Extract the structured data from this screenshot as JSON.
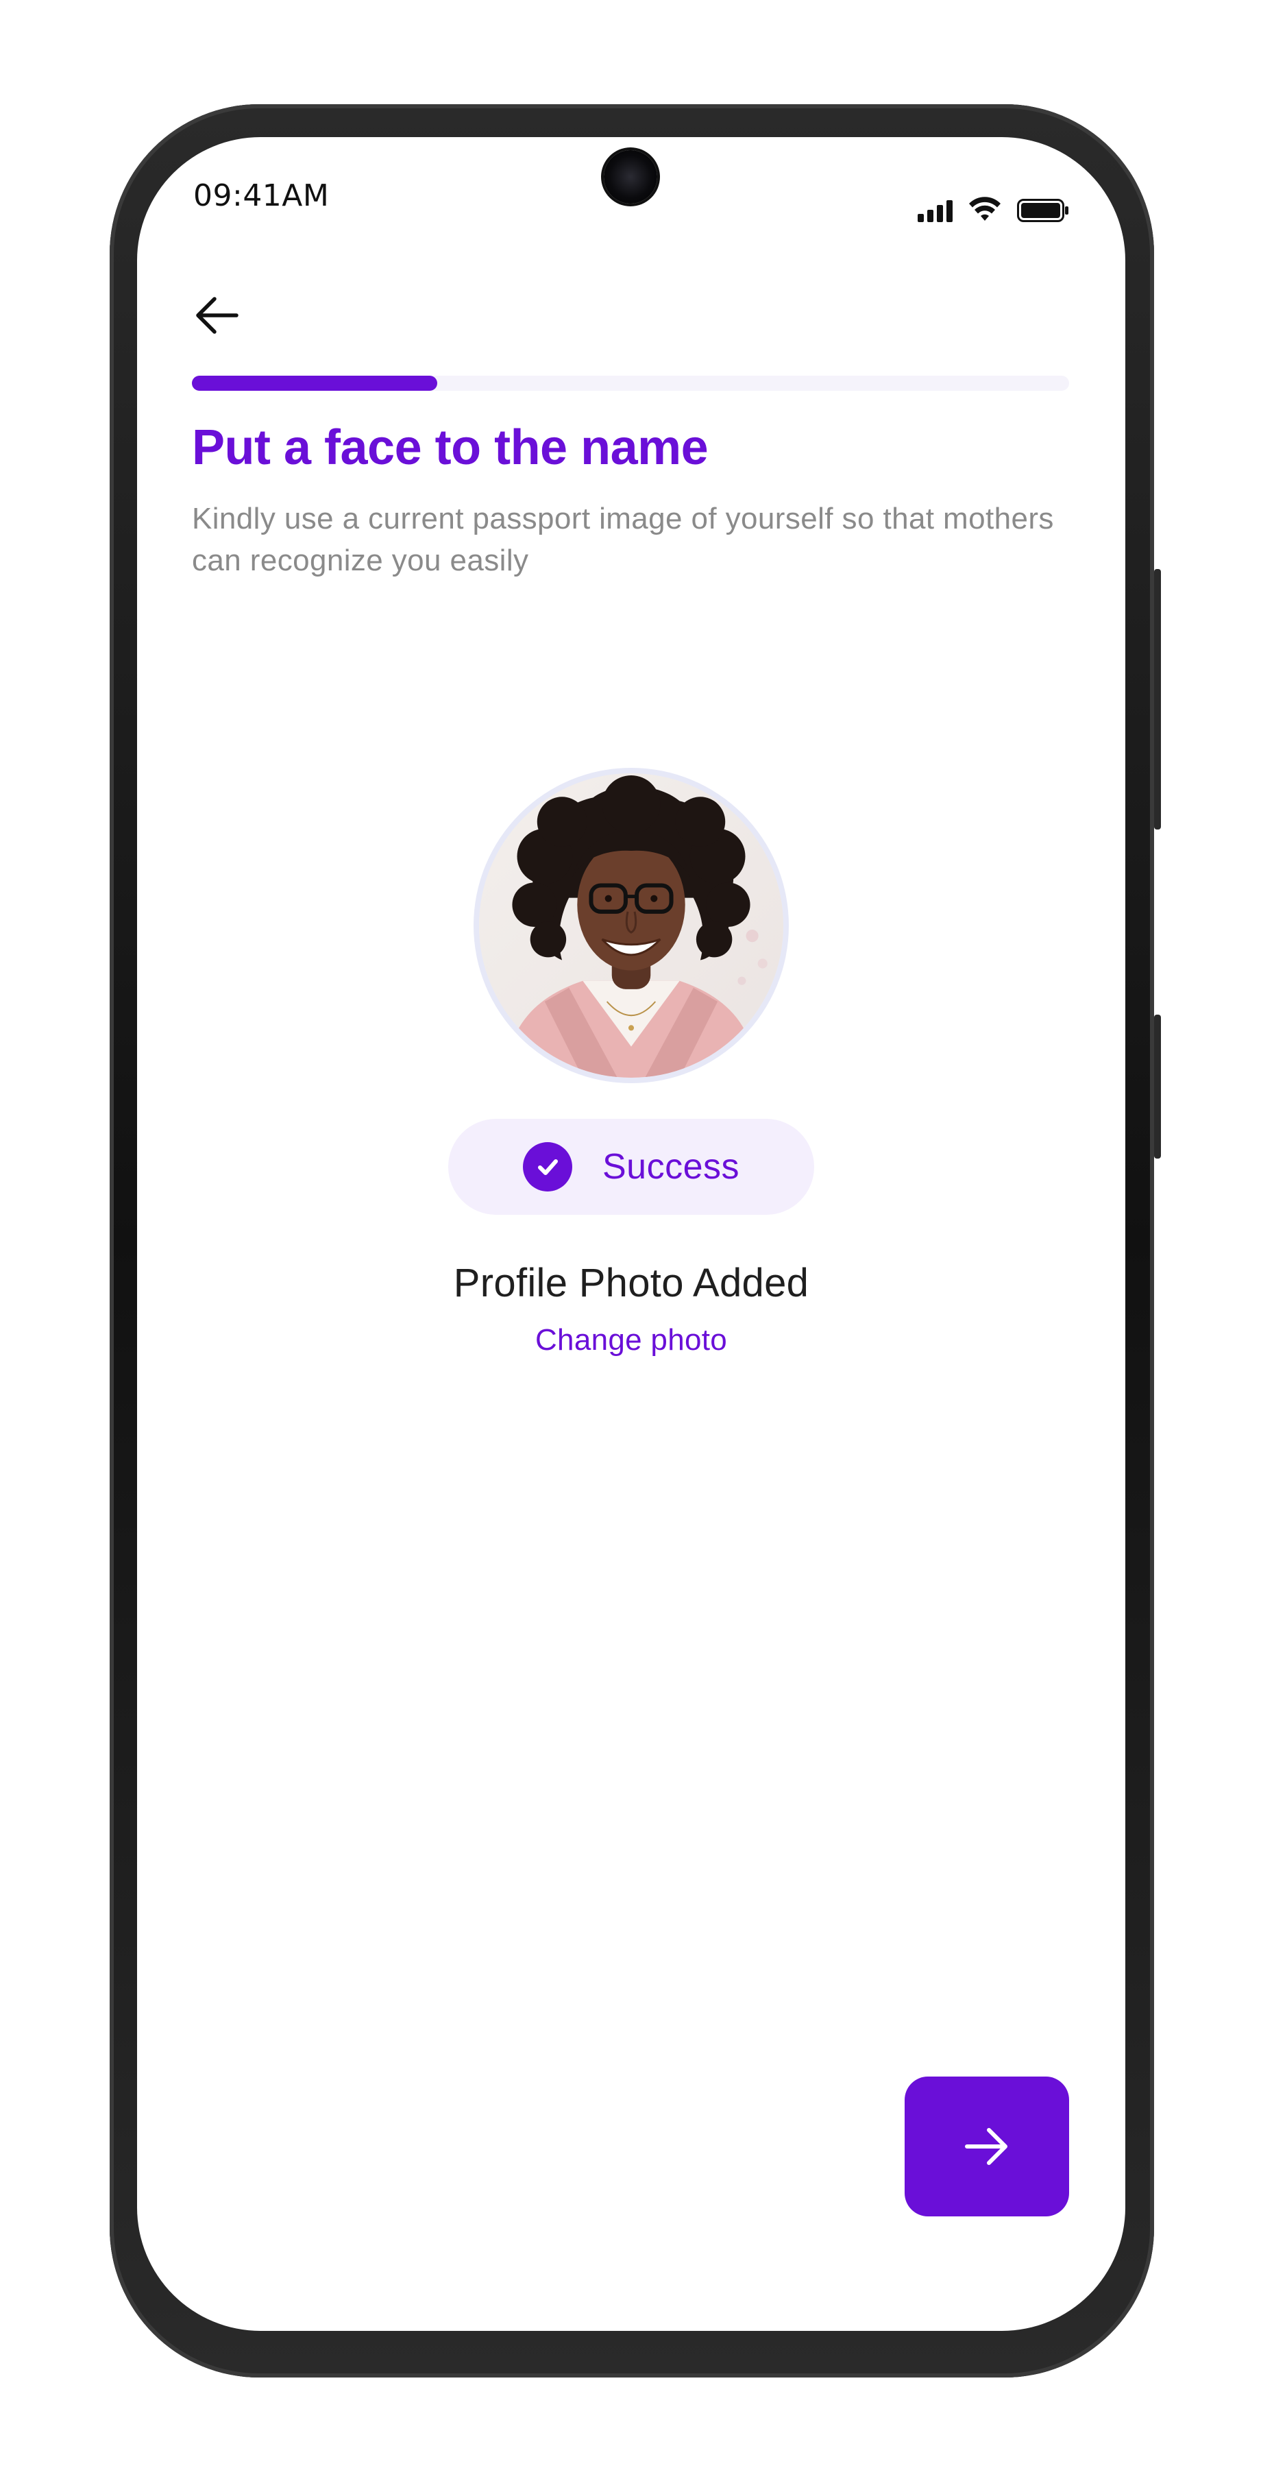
{
  "status_bar": {
    "time": "09:41AM",
    "icons": [
      "signal-icon",
      "wifi-icon",
      "battery-icon"
    ]
  },
  "header": {
    "back_icon": "arrow-left-icon"
  },
  "progress": {
    "fraction": 0.28
  },
  "main": {
    "title": "Put a face to the name",
    "subtitle": "Kindly use a current passport image of yourself so that mothers can recognize you easily",
    "status_badge": {
      "icon": "check-circle-icon",
      "label": "Success"
    },
    "photo_status": "Profile Photo Added",
    "change_photo_link": "Change photo"
  },
  "footer": {
    "next_icon": "arrow-right-icon"
  },
  "colors": {
    "accent": "#6a0fd8",
    "badge_bg": "#f4effd",
    "subtitle": "#8a8a8a",
    "progress_track": "#f5f3fb"
  }
}
